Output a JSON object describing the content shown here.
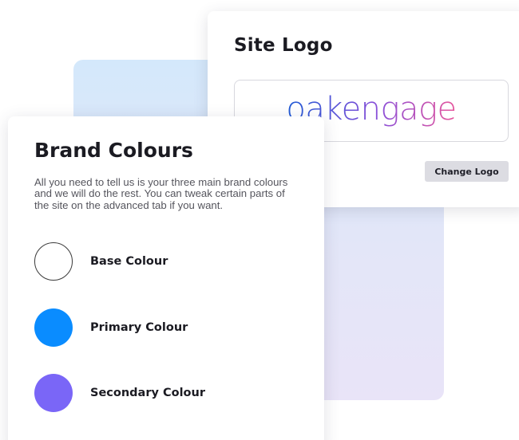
{
  "site_logo": {
    "title": "Site Logo",
    "logo_text": "oakengage",
    "change_button_label": "Change Logo",
    "logo_gradient": [
      "#1f5bd6",
      "#8c4fd8",
      "#e7579c"
    ]
  },
  "brand_colours": {
    "title": "Brand Colours",
    "description": "All you need to tell us is your three main brand colours and we will do the rest. You can tweak certain parts of the site on the advanced tab if you want.",
    "colours": [
      {
        "label": "Base Colour",
        "color": "#ffffff"
      },
      {
        "label": "Primary Colour",
        "color": "#0a8cff"
      },
      {
        "label": "Secondary Colour",
        "color": "#7a66f7"
      }
    ]
  }
}
